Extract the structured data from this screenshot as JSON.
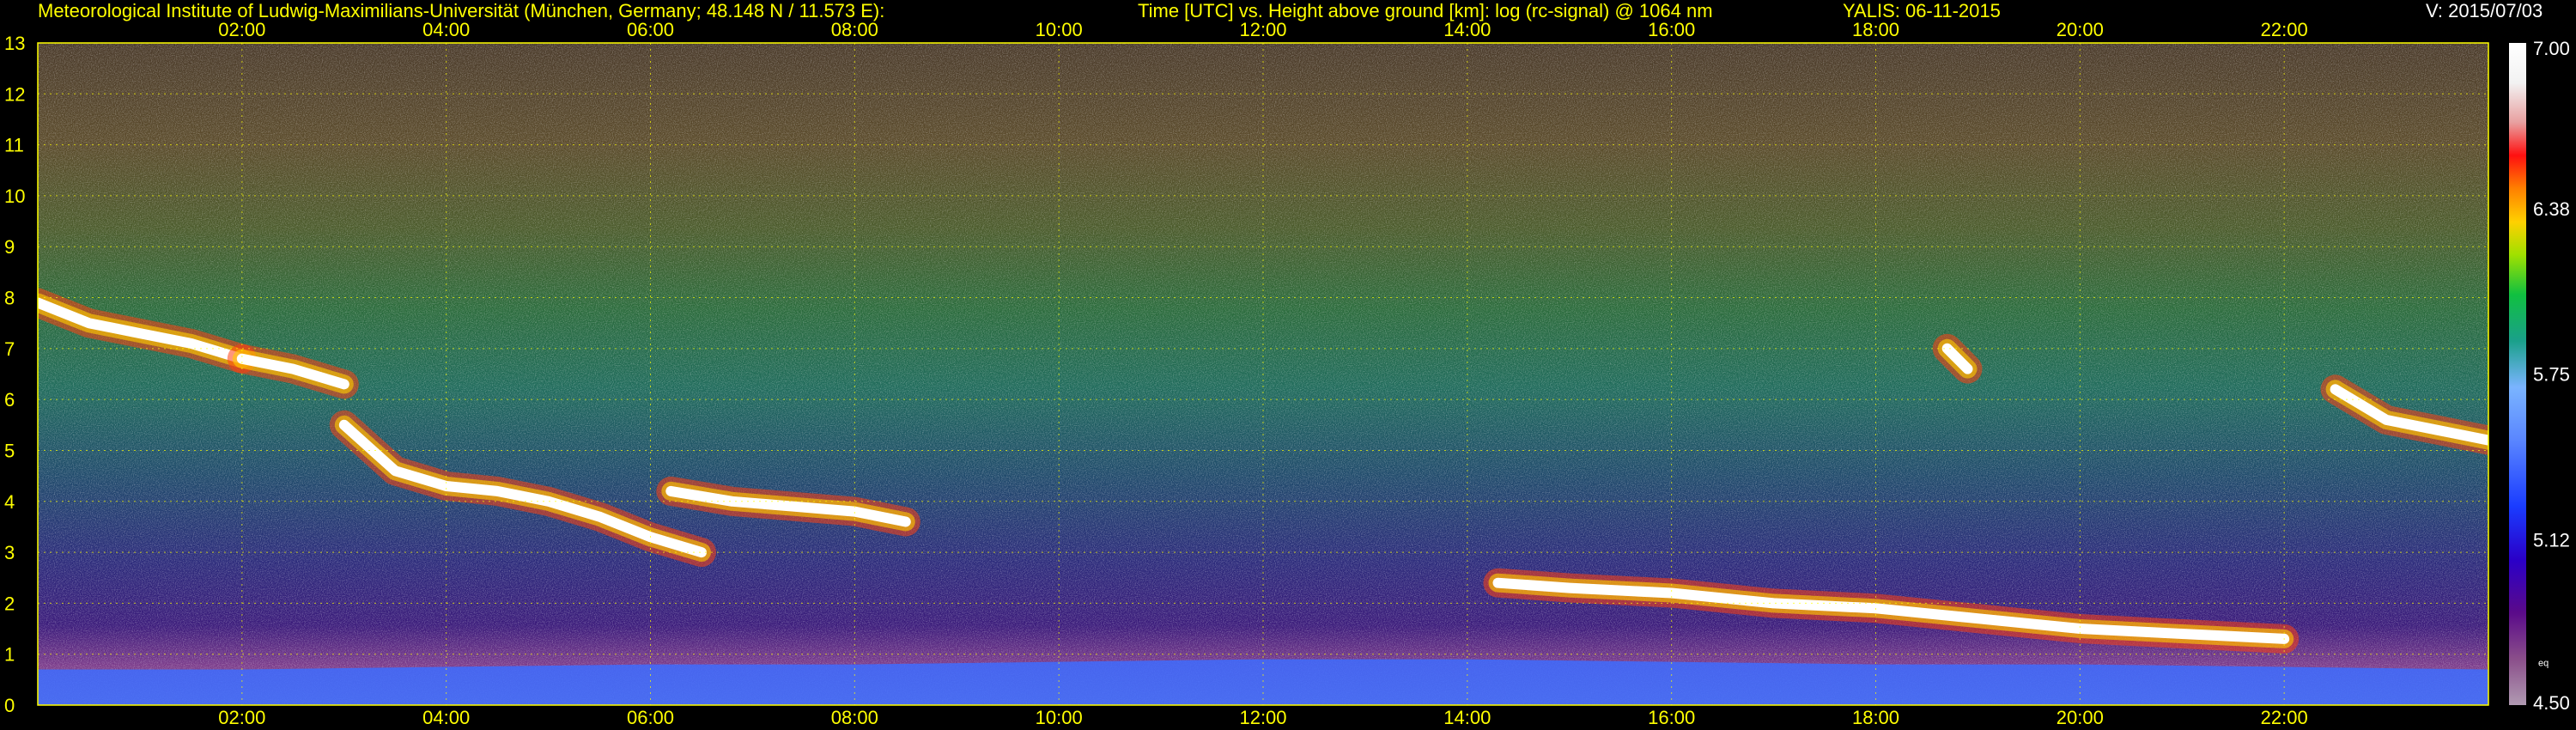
{
  "header": {
    "institute": "Meteorological Institute of Ludwig-Maximilians-Universität (München, Germany; 48.148 N / 11.573 E):",
    "plot_title": "Time [UTC] vs. Height above ground [km]: log (rc-signal) @ 1064 nm",
    "station_date": "YALIS: 06-11-2015",
    "version": "V: 2015/07/03"
  },
  "chart_data": {
    "type": "heatmap",
    "title": "Time [UTC] vs. Height above ground [km]: log (rc-signal) @ 1064 nm",
    "xlabel": "Time [UTC]",
    "ylabel": "Height above ground [km]",
    "xlim": [
      0,
      24
    ],
    "ylim": [
      0,
      13
    ],
    "x_tick_labels": [
      "02:00",
      "04:00",
      "06:00",
      "08:00",
      "10:00",
      "12:00",
      "14:00",
      "16:00",
      "18:00",
      "20:00",
      "22:00"
    ],
    "x_tick_hours": [
      2,
      4,
      6,
      8,
      10,
      12,
      14,
      16,
      18,
      20,
      22
    ],
    "y_tick_labels": [
      "0",
      "1",
      "2",
      "3",
      "4",
      "5",
      "6",
      "7",
      "8",
      "9",
      "10",
      "11",
      "12",
      "13"
    ],
    "grid": true,
    "colorbar": {
      "range": [
        4.5,
        7.0
      ],
      "tick_labels": [
        "7.00",
        "6.38",
        "5.75",
        "5.12",
        "4.50"
      ],
      "tick_values": [
        7.0,
        6.375,
        5.75,
        5.125,
        4.5
      ],
      "small_label": "eq",
      "small_label_value": 4.66
    },
    "features": [
      {
        "kind": "cloud",
        "t": [
          0.0,
          0.5,
          1.0,
          1.5,
          2.0
        ],
        "z": [
          7.9,
          7.5,
          7.3,
          7.1,
          6.8
        ]
      },
      {
        "kind": "cloud",
        "t": [
          2.0,
          2.5,
          3.0
        ],
        "z": [
          6.8,
          6.6,
          6.3
        ]
      },
      {
        "kind": "cloud",
        "t": [
          3.0,
          3.5,
          4.0,
          4.5,
          5.0,
          5.5,
          6.0,
          6.5
        ],
        "z": [
          5.5,
          4.6,
          4.3,
          4.2,
          4.0,
          3.7,
          3.3,
          3.0
        ]
      },
      {
        "kind": "cloud",
        "t": [
          6.2,
          6.8,
          7.4,
          8.0,
          8.5
        ],
        "z": [
          4.2,
          4.0,
          3.9,
          3.8,
          3.6
        ]
      },
      {
        "kind": "cloud",
        "t": [
          14.3,
          15.0,
          16.0,
          17.0,
          18.0,
          19.0,
          20.0,
          21.0,
          22.0
        ],
        "z": [
          2.4,
          2.3,
          2.2,
          2.0,
          1.9,
          1.7,
          1.5,
          1.4,
          1.3
        ]
      },
      {
        "kind": "cloud",
        "t": [
          18.7,
          18.9
        ],
        "z": [
          7.0,
          6.6
        ]
      },
      {
        "kind": "cloud",
        "t": [
          22.5,
          23.0,
          23.5,
          24.0
        ],
        "z": [
          6.2,
          5.6,
          5.4,
          5.2
        ]
      }
    ],
    "boundary_layer_top_km": [
      0.7,
      0.7,
      0.75,
      0.8,
      0.8,
      0.85,
      0.9,
      0.9,
      0.85,
      0.8,
      0.8,
      0.75,
      0.7
    ]
  }
}
